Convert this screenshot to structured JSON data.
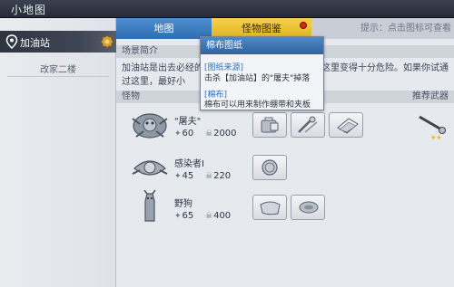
{
  "window": {
    "title": "小地图"
  },
  "sidebar": {
    "location_label": "加油站",
    "sub_items": [
      "改家二楼"
    ]
  },
  "tabs": {
    "map": "地图",
    "monster_guide": "怪物图鉴",
    "hint": "提示：点击图标可查看"
  },
  "intro": {
    "heading": "场景简介",
    "text": "加油站是出去必经的…………………………，使得这里变得十分危险。如果你试通过这里，最好小"
  },
  "monsters": {
    "heading": "怪物",
    "weapon_heading": "推荐武器",
    "rows": [
      {
        "name": "\"屠夫\"",
        "stat1": "60",
        "stat2": "2000",
        "stat1_icon": "paw-icon",
        "stat2_icon": "skull-icon"
      },
      {
        "name": "感染者I",
        "stat1": "45",
        "stat2": "220",
        "stat1_icon": "paw-icon",
        "stat2_icon": "skull-icon"
      },
      {
        "name": "野狗",
        "stat1": "65",
        "stat2": "400",
        "stat1_icon": "paw-icon",
        "stat2_icon": "skull-icon"
      }
    ]
  },
  "popup": {
    "title": "棉布图纸",
    "section1_label": "[图纸来源]",
    "section1_text": "击杀【加油站】的\"屠夫\"掉落",
    "section2_label": "[棉布]",
    "section2_text": "棉布可以用来制作绷带和夹板"
  },
  "colors": {
    "tab_active_blue": "#2e6db0",
    "tab_gold": "#e0b322",
    "notification_red": "#d8261c"
  }
}
